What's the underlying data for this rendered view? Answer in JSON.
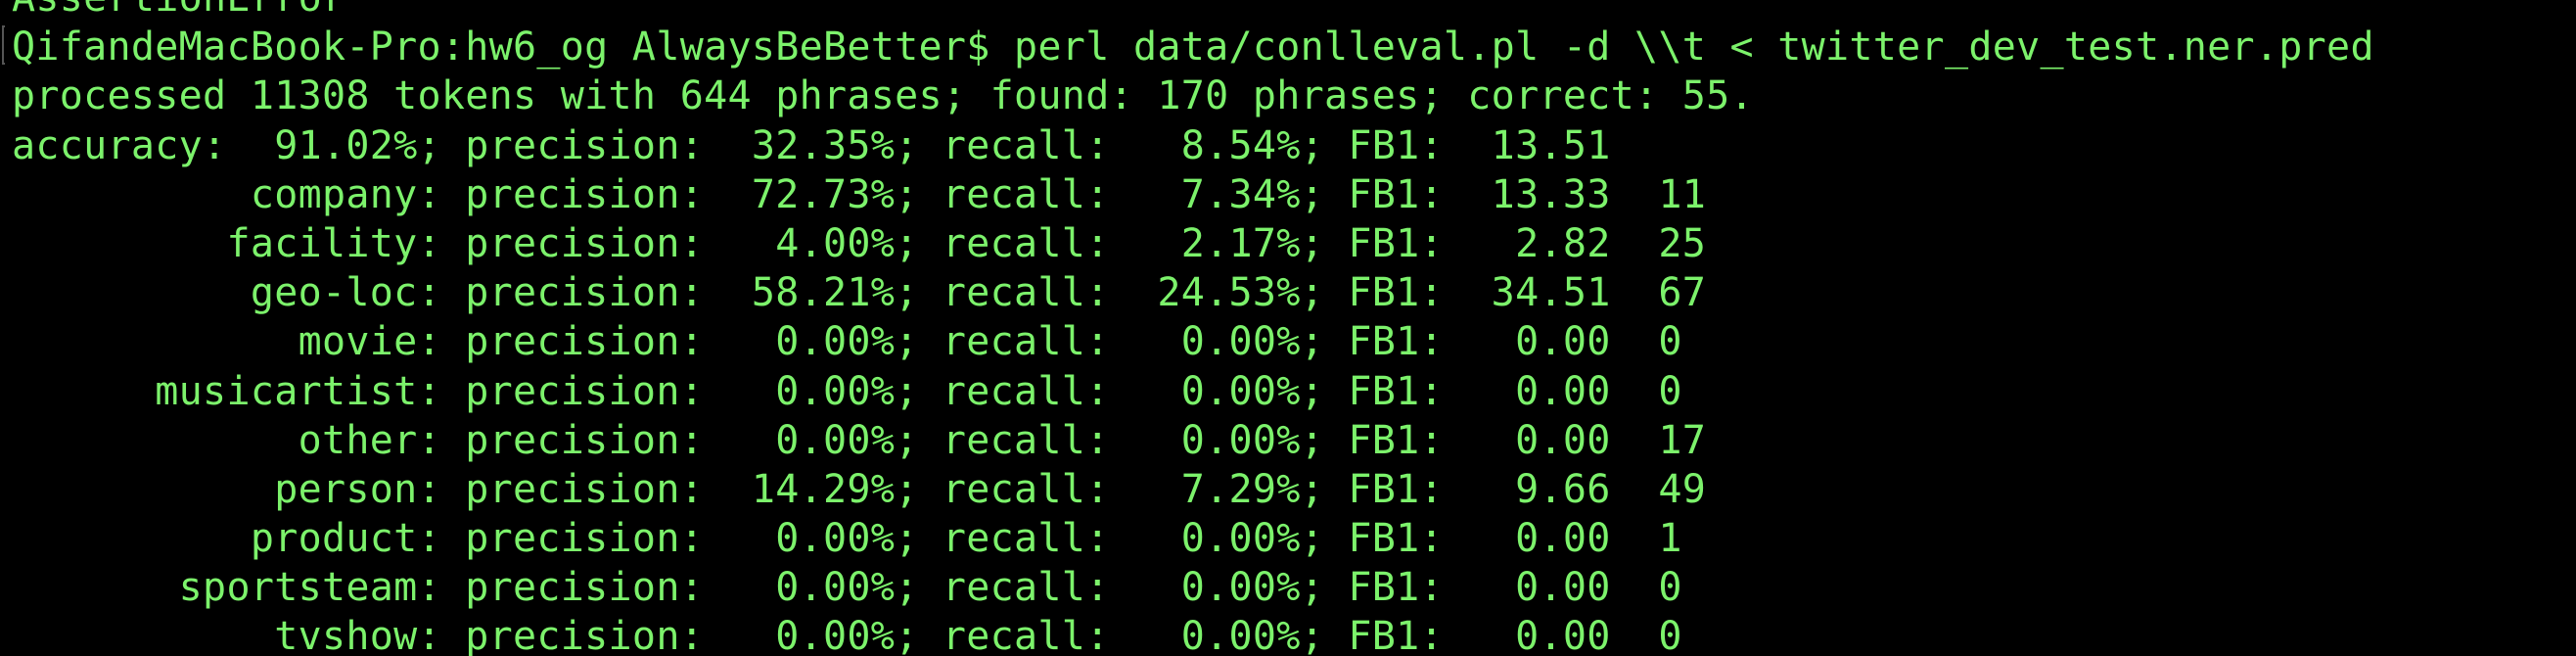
{
  "terminal": {
    "lines": [
      "AssertionError",
      "QifandeMacBook-Pro:hw6_og AlwaysBeBetter$ perl data/conlleval.pl -d \\\\t < twitter_dev_test.ner.pred",
      "processed 11308 tokens with 644 phrases; found: 170 phrases; correct: 55.",
      "accuracy:  91.02%; precision:  32.35%; recall:   8.54%; FB1:  13.51",
      "          company: precision:  72.73%; recall:   7.34%; FB1:  13.33  11",
      "         facility: precision:   4.00%; recall:   2.17%; FB1:   2.82  25",
      "          geo-loc: precision:  58.21%; recall:  24.53%; FB1:  34.51  67",
      "            movie: precision:   0.00%; recall:   0.00%; FB1:   0.00  0",
      "      musicartist: precision:   0.00%; recall:   0.00%; FB1:   0.00  0",
      "            other: precision:   0.00%; recall:   0.00%; FB1:   0.00  17",
      "           person: precision:  14.29%; recall:   7.29%; FB1:   9.66  49",
      "          product: precision:   0.00%; recall:   0.00%; FB1:   0.00  1",
      "       sportsteam: precision:   0.00%; recall:   0.00%; FB1:   0.00  0",
      "           tvshow: precision:   0.00%; recall:   0.00%; FB1:   0.00  0"
    ]
  },
  "colors": {
    "background": "#000000",
    "text": "#7cf26b"
  }
}
